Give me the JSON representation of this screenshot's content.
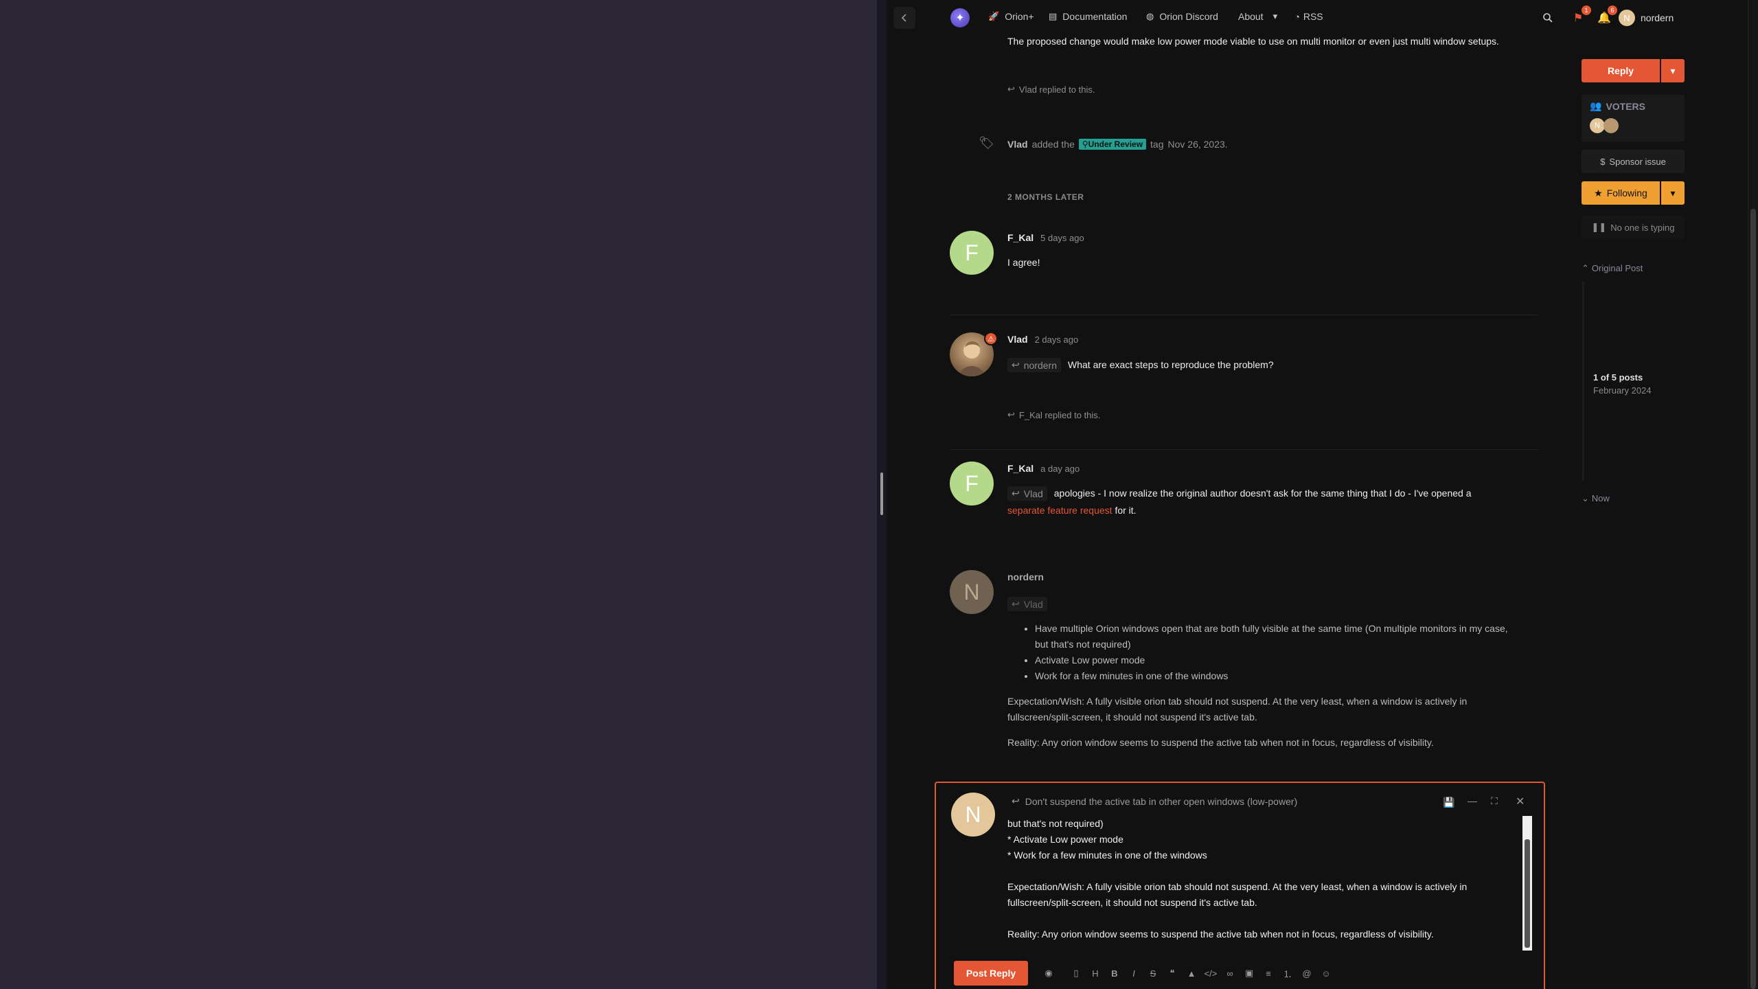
{
  "header": {
    "nav": [
      {
        "icon": "rocket-icon",
        "label": "Orion+"
      },
      {
        "icon": "book-icon",
        "label": "Documentation"
      },
      {
        "icon": "discord-icon",
        "label": "Orion Discord"
      },
      {
        "icon": "chevron-down-icon",
        "label": "About"
      },
      {
        "icon": "rss-icon",
        "label": "RSS"
      }
    ],
    "notif_badge_1": "1",
    "notif_badge_2": "6",
    "user_initial": "N",
    "username": "nordern"
  },
  "stream": {
    "intro_text": "The proposed change would make low power mode viable to use on multi monitor or even just multi window setups.",
    "vlad_replied_text": "Vlad replied to this.",
    "tag_event": {
      "user": "Vlad",
      "before": "added the",
      "tag": "Under Review",
      "after": "tag",
      "date": "Nov 26, 2023."
    },
    "time_gap": "2 MONTHS LATER",
    "posts": [
      {
        "avatar": "F",
        "user": "F_Kal",
        "date": "5 days ago",
        "text": "I agree!"
      },
      {
        "avatar": "",
        "user": "Vlad",
        "date": "2 days ago",
        "reply_to": "nordern",
        "text": "What are exact steps to reproduce the problem?",
        "replied": "F_Kal replied to this."
      },
      {
        "avatar": "F",
        "user": "F_Kal",
        "date": "a day ago",
        "reply_to": "Vlad",
        "text": "apologies - I now realize the original author doesn't ask for the same thing that I do - I've opened a",
        "link": "separate feature request",
        "text_after": "for it."
      },
      {
        "avatar": "N",
        "user": "nordern",
        "reply_to": "Vlad",
        "bullets": [
          "Have multiple Orion windows open that are both fully visible at the same time (On multiple monitors in my case,",
          "but that's not required)",
          "Activate Low power mode",
          "Work for a few minutes in one of the windows"
        ],
        "expectation": "Expectation/Wish: A fully visible orion tab should not suspend. At the very least, when a window is actively in",
        "expectation2": "fullscreen/split-screen, it should not suspend it's active tab.",
        "reality": "Reality: Any orion window seems to suspend the active tab when not in focus, regardless of visibility."
      }
    ]
  },
  "sidebar": {
    "reply": "Reply",
    "voters": "VOTERS",
    "sponsor": "Sponsor issue",
    "following": "Following",
    "typing": "No one is typing",
    "original_post": "Original Post",
    "position": "1 of 5 posts",
    "position_date": "February 2024",
    "now": "Now"
  },
  "composer": {
    "avatar": "N",
    "title": "Don't suspend the active tab in other open windows (low-power)",
    "content": "but that's not required)\n* Activate Low power mode\n* Work for a few minutes in one of the windows\n\nExpectation/Wish: A fully visible orion tab should not suspend. At the very least, when a window is actively in\nfullscreen/split-screen, it should not suspend it's active tab.\n\nReality: Any orion window seems to suspend the active tab when not in focus, regardless of visibility.",
    "post_button": "Post Reply"
  },
  "colors": {
    "accent": "#e45735",
    "amber": "#f0a030",
    "tag": "#23a091"
  }
}
